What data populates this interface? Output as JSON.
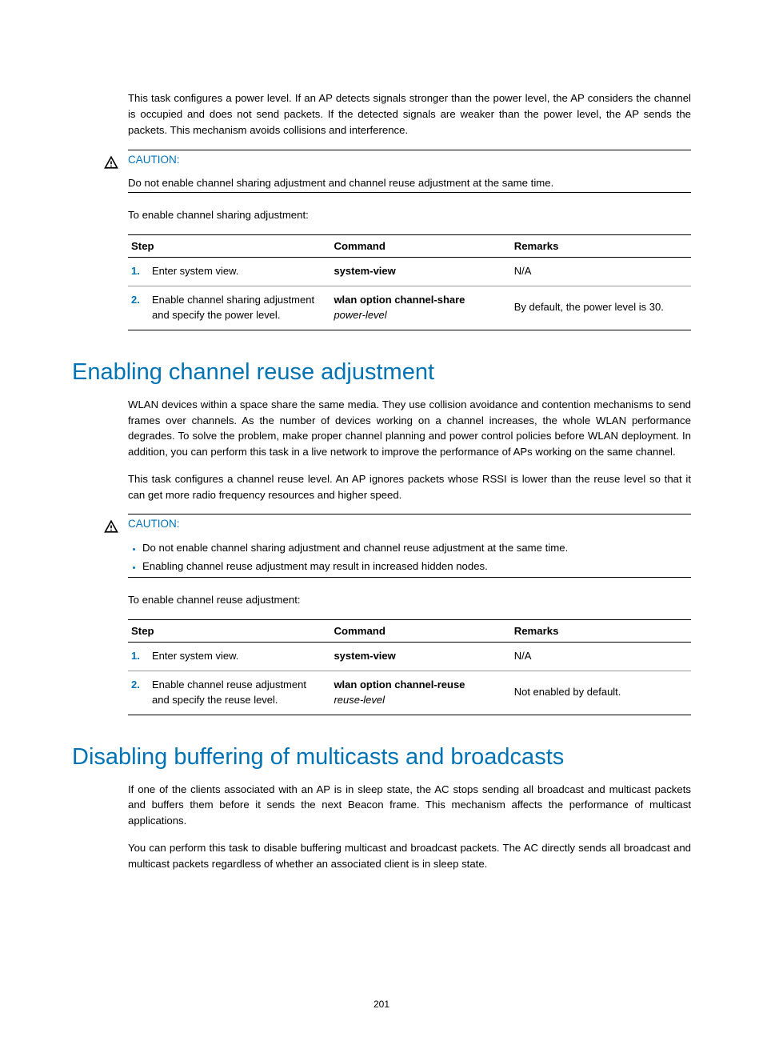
{
  "intro_para": "This task configures a power level. If an AP detects signals stronger than the power level, the AP considers the channel is occupied and does not send packets. If the detected signals are weaker than the power level, the AP sends the packets. This mechanism avoids collisions and interference.",
  "caution1": {
    "label": "CAUTION:",
    "text": "Do not enable channel sharing adjustment and channel reuse adjustment at the same time."
  },
  "lead1": "To enable channel sharing adjustment:",
  "table1": {
    "headers": {
      "step": "Step",
      "command": "Command",
      "remarks": "Remarks"
    },
    "rows": [
      {
        "num": "1.",
        "desc": "Enter system view.",
        "cmd_bold": "system-view",
        "cmd_ital": "",
        "remarks": "N/A"
      },
      {
        "num": "2.",
        "desc": "Enable channel sharing adjustment and specify the power level.",
        "cmd_bold": "wlan option channel-share",
        "cmd_ital": "power-level",
        "remarks": "By default, the power level is 30."
      }
    ]
  },
  "heading1": "Enabling channel reuse adjustment",
  "para2": "WLAN devices within a space share the same media. They use collision avoidance and contention mechanisms to send frames over channels. As the number of devices working on a channel increases, the whole WLAN performance degrades. To solve the problem, make proper channel planning and power control policies before WLAN deployment. In addition, you can perform this task in a live network to improve the performance of APs working on the same channel.",
  "para3": "This task configures a channel reuse level. An AP ignores packets whose RSSI is lower than the reuse level so that it can get more radio frequency resources and higher speed.",
  "caution2": {
    "label": "CAUTION:",
    "items": [
      "Do not enable channel sharing adjustment and channel reuse adjustment at the same time.",
      "Enabling channel reuse adjustment may result in increased hidden nodes."
    ]
  },
  "lead2": "To enable channel reuse adjustment:",
  "table2": {
    "headers": {
      "step": "Step",
      "command": "Command",
      "remarks": "Remarks"
    },
    "rows": [
      {
        "num": "1.",
        "desc": "Enter system view.",
        "cmd_bold": "system-view",
        "cmd_ital": "",
        "remarks": "N/A"
      },
      {
        "num": "2.",
        "desc": "Enable channel reuse adjustment and specify the reuse level.",
        "cmd_bold": "wlan option channel-reuse",
        "cmd_ital": "reuse-level",
        "remarks": "Not enabled by default."
      }
    ]
  },
  "heading2": "Disabling buffering of multicasts and broadcasts",
  "para4": "If one of the clients associated with an AP is in sleep state, the AC stops sending all broadcast and multicast packets and buffers them before it sends the next Beacon frame. This mechanism affects the performance of multicast applications.",
  "para5": "You can perform this task to disable buffering multicast and broadcast packets. The AC directly sends all broadcast and multicast packets regardless of whether an associated client is in sleep state.",
  "page_number": "201"
}
